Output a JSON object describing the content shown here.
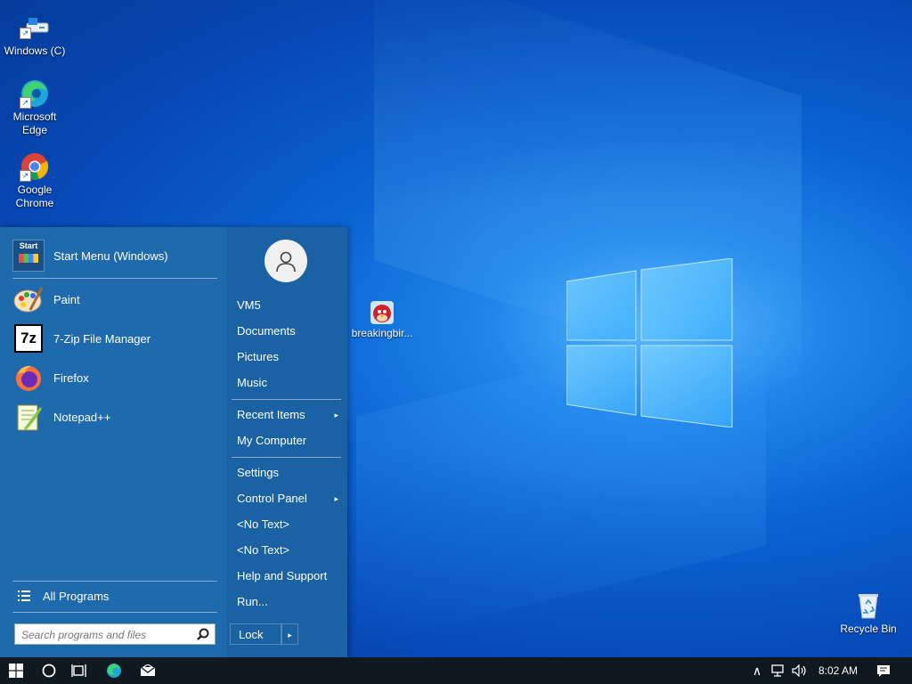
{
  "desktop": {
    "icons": [
      {
        "label": "Windows (C)"
      },
      {
        "label": "Microsoft Edge"
      },
      {
        "label": "Google Chrome"
      },
      {
        "label": "breakingbir..."
      },
      {
        "label": "Recycle Bin"
      }
    ]
  },
  "start_menu": {
    "pinned": [
      {
        "label": "Start Menu (Windows)",
        "icon": "start-menu-app-icon"
      },
      {
        "label": "Paint",
        "icon": "paint-icon"
      },
      {
        "label": "7-Zip File Manager",
        "icon": "7zip-icon",
        "icon_text": "7z"
      },
      {
        "label": "Firefox",
        "icon": "firefox-icon"
      },
      {
        "label": "Notepad++",
        "icon": "notepadpp-icon"
      }
    ],
    "start_icon_text": "Start",
    "all_programs": "All Programs",
    "search_placeholder": "Search programs and files",
    "right": [
      {
        "label": "VM5"
      },
      {
        "label": "Documents"
      },
      {
        "label": "Pictures"
      },
      {
        "label": "Music"
      },
      {
        "label": "Recent Items",
        "submenu": true
      },
      {
        "label": "My Computer"
      },
      {
        "label": "Settings"
      },
      {
        "label": "Control Panel",
        "submenu": true
      },
      {
        "label": "<No Text>"
      },
      {
        "label": "<No Text>"
      },
      {
        "label": "Help and Support"
      },
      {
        "label": "Run..."
      }
    ],
    "submenu_arrow": "▸",
    "lock_label": "Lock",
    "lock_arrow": "▸"
  },
  "taskbar": {
    "time": "8:02 AM",
    "tray_chevron": "∧"
  },
  "colors": {
    "menu_bg": "#1e6aad",
    "taskbar_bg": "#101820"
  }
}
